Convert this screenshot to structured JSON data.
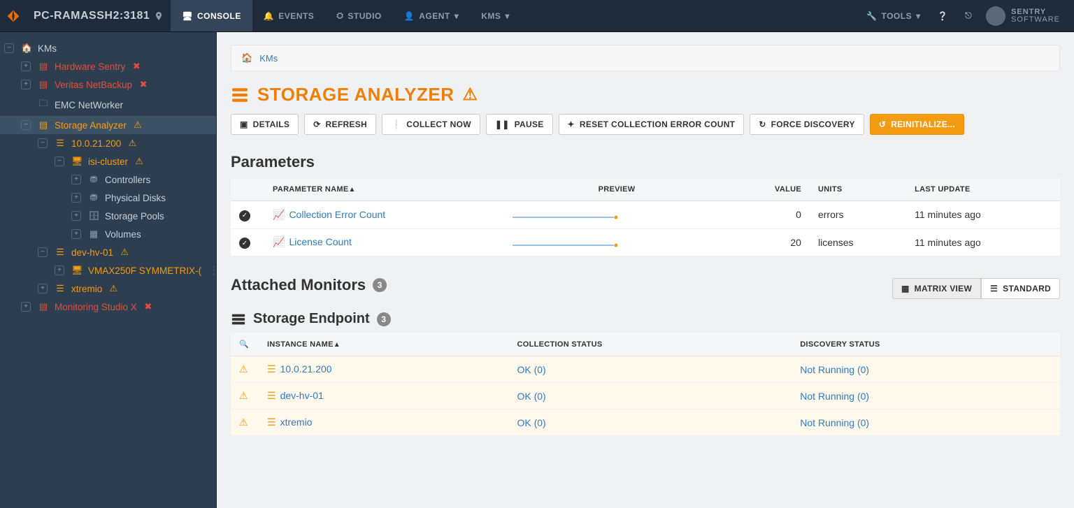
{
  "header": {
    "host": "PC-RAMASSH2:3181",
    "tabs": {
      "console": "CONSOLE",
      "events": "EVENTS",
      "studio": "STUDIO",
      "agent": "AGENT",
      "kms": "KMs"
    },
    "tools": "TOOLS",
    "brand1": "SENTRY",
    "brand2": "SOFTWARE"
  },
  "tree": {
    "root": "KMs",
    "hardware_sentry": "Hardware Sentry",
    "veritas": "Veritas NetBackup",
    "emc": "EMC NetWorker",
    "storage_analyzer": "Storage Analyzer",
    "ip": "10.0.21.200",
    "isi": "isi-cluster",
    "controllers": "Controllers",
    "physical_disks": "Physical Disks",
    "storage_pools": "Storage Pools",
    "volumes": "Volumes",
    "devhv": "dev-hv-01",
    "vmax": "VMAX250F SYMMETRIX-(",
    "xtremio": "xtremio",
    "monitoring_studio": "Monitoring Studio X"
  },
  "breadcrumb": {
    "kms": "KMs"
  },
  "page": {
    "title": "STORAGE ANALYZER"
  },
  "actions": {
    "details": "DETAILS",
    "refresh": "REFRESH",
    "collect_now": "COLLECT NOW",
    "pause": "PAUSE",
    "reset": "RESET COLLECTION ERROR COUNT",
    "force": "FORCE DISCOVERY",
    "reinit": "REINITIALIZE..."
  },
  "parameters": {
    "heading": "Parameters",
    "cols": {
      "name": "PARAMETER NAME",
      "preview": "PREVIEW",
      "value": "VALUE",
      "units": "UNITS",
      "last": "LAST UPDATE"
    },
    "rows": [
      {
        "name": "Collection Error Count",
        "value": "0",
        "units": "errors",
        "last": "11 minutes ago"
      },
      {
        "name": "License Count",
        "value": "20",
        "units": "licenses",
        "last": "11 minutes ago"
      }
    ]
  },
  "monitors": {
    "heading": "Attached Monitors",
    "count": "3",
    "views": {
      "matrix": "MATRIX VIEW",
      "standard": "STANDARD"
    },
    "endpoint_heading": "Storage Endpoint",
    "endpoint_count": "3",
    "cols": {
      "name": "INSTANCE NAME",
      "collection": "COLLECTION STATUS",
      "discovery": "DISCOVERY STATUS"
    },
    "rows": [
      {
        "name": "10.0.21.200",
        "collection": "OK (0)",
        "discovery": "Not Running (0)"
      },
      {
        "name": "dev-hv-01",
        "collection": "OK (0)",
        "discovery": "Not Running (0)"
      },
      {
        "name": "xtremio",
        "collection": "OK (0)",
        "discovery": "Not Running (0)"
      }
    ]
  }
}
